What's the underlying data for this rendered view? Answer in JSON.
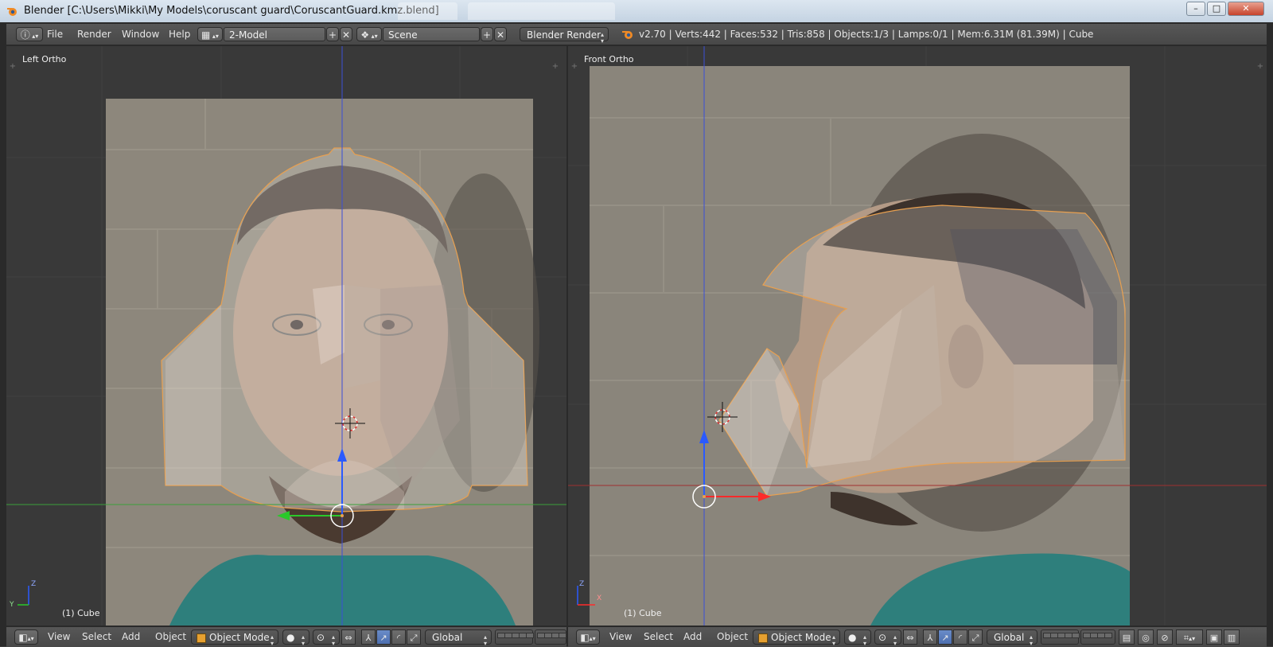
{
  "window": {
    "title": "Blender [C:\\Users\\Mikki\\My Models\\coruscant guard\\CoruscantGuard.kmz.blend]",
    "controls": {
      "minimize": "–",
      "maximize": "□",
      "close": "✕"
    }
  },
  "info_header": {
    "menus": [
      "File",
      "Render",
      "Window",
      "Help"
    ],
    "screen_layout": "2-Model",
    "scene": "Scene",
    "render_engine": "Blender Render",
    "stats": "v2.70 | Verts:442 | Faces:532 | Tris:858 | Objects:1/3 | Lamps:0/1 | Mem:6.31M (81.39M) | Cube"
  },
  "viewports": {
    "left": {
      "label": "Left Ortho",
      "object": "(1) Cube",
      "axis_up": "Z",
      "axis_side": "Y"
    },
    "right": {
      "label": "Front Ortho",
      "object": "(1) Cube",
      "axis_up": "Z",
      "axis_side": "X"
    }
  },
  "footer": {
    "menus": [
      "View",
      "Select",
      "Add",
      "Object"
    ],
    "mode": "Object Mode",
    "orientation": "Global"
  },
  "colors": {
    "axis_x": "#ff2a2a",
    "axis_y": "#2ac82a",
    "axis_z": "#2a5aff",
    "selection_outline": "#e8a050",
    "active_button": "#5577bb"
  }
}
